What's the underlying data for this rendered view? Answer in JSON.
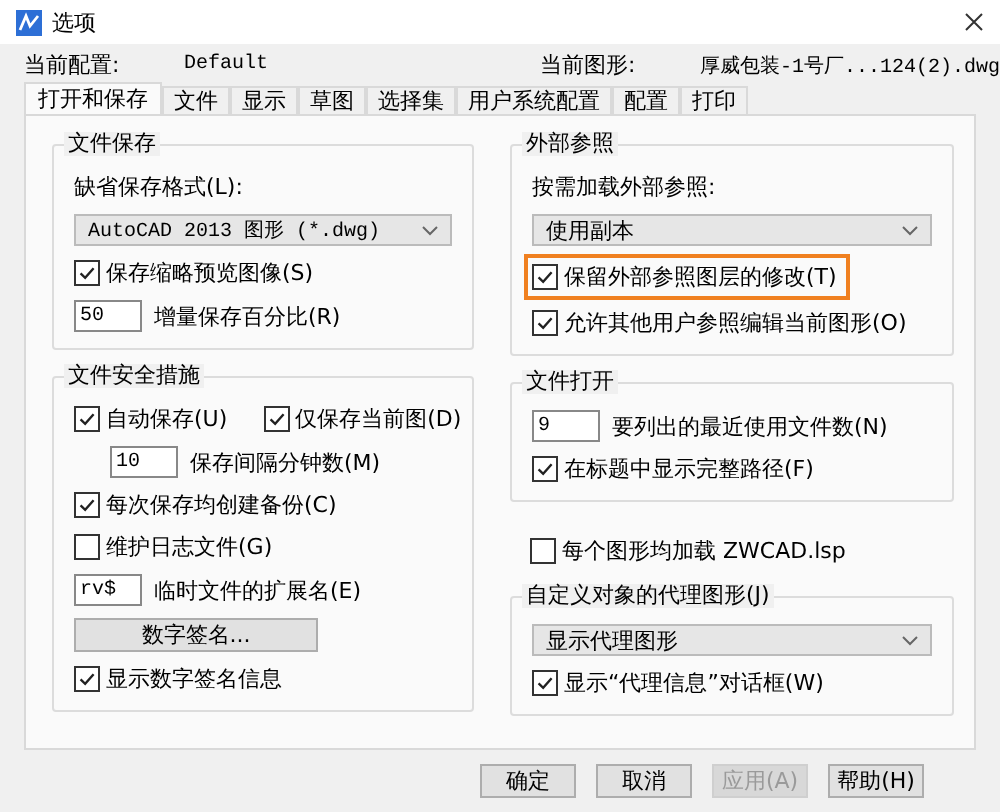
{
  "window": {
    "title": "选项"
  },
  "info": [
    {
      "label": "当前配置:",
      "value": "Default"
    },
    {
      "label": "当前图形:",
      "value": "厚威包装-1号厂...124(2).dwg"
    }
  ],
  "tabs": [
    {
      "label": "打开和保存",
      "selected": true
    },
    {
      "label": "文件",
      "selected": false
    },
    {
      "label": "显示",
      "selected": false
    },
    {
      "label": "草图",
      "selected": false
    },
    {
      "label": "选择集",
      "selected": false
    },
    {
      "label": "用户系统配置",
      "selected": false
    },
    {
      "label": "配置",
      "selected": false
    },
    {
      "label": "打印",
      "selected": false
    }
  ],
  "left_groups": [
    {
      "title": "文件保存",
      "items": [
        {
          "kind": "label",
          "text": "缺省保存格式(L):"
        },
        {
          "kind": "select",
          "value": "AutoCAD 2013 图形 (*.dwg)"
        },
        {
          "kind": "checkbox",
          "label": "保存缩略预览图像(S)",
          "checked": true
        },
        {
          "kind": "field",
          "value": "50",
          "caption": "增量保存百分比(R)"
        }
      ]
    },
    {
      "title": "文件安全措施",
      "items": [
        {
          "kind": "checkrow",
          "checks": [
            {
              "label": "自动保存(U)",
              "checked": true
            },
            {
              "label": "仅保存当前图(D)",
              "checked": true
            }
          ]
        },
        {
          "kind": "subfield",
          "value": "10",
          "caption": "保存间隔分钟数(M)"
        },
        {
          "kind": "checkbox",
          "label": "每次保存均创建备份(C)",
          "checked": true
        },
        {
          "kind": "checkbox",
          "label": "维护日志文件(G)",
          "checked": false
        },
        {
          "kind": "field",
          "value": "rv$",
          "caption": "临时文件的扩展名(E)"
        },
        {
          "kind": "button",
          "label": "数字签名..."
        },
        {
          "kind": "checkbox",
          "label": "显示数字签名信息",
          "checked": true
        }
      ]
    }
  ],
  "right_groups": [
    {
      "title": "外部参照",
      "items": [
        {
          "kind": "label",
          "text": "按需加载外部参照:"
        },
        {
          "kind": "select",
          "value": "使用副本"
        },
        {
          "kind": "checkbox",
          "label": "保留外部参照图层的修改(T)",
          "checked": true,
          "highlighted": true
        },
        {
          "kind": "checkbox",
          "label": "允许其他用户参照编辑当前图形(O)",
          "checked": true
        }
      ]
    },
    {
      "title": "文件打开",
      "items": [
        {
          "kind": "field",
          "value": "9",
          "caption": "要列出的最近使用文件数(N)"
        },
        {
          "kind": "checkbox",
          "label": "在标题中显示完整路径(F)",
          "checked": true
        }
      ]
    },
    {
      "items": [
        {
          "kind": "checkbox",
          "label": "每个图形均加载 ZWCAD.lsp",
          "checked": false
        }
      ]
    },
    {
      "title": "自定义对象的代理图形(J)",
      "items": [
        {
          "kind": "select",
          "value": "显示代理图形"
        },
        {
          "kind": "checkbox",
          "label": "显示“代理信息”对话框(W)",
          "checked": true
        }
      ]
    }
  ],
  "buttons": [
    {
      "label": "确定",
      "disabled": false
    },
    {
      "label": "取消",
      "disabled": false
    },
    {
      "label": "应用(A)",
      "disabled": true
    },
    {
      "label": "帮助(H)",
      "disabled": false
    }
  ]
}
